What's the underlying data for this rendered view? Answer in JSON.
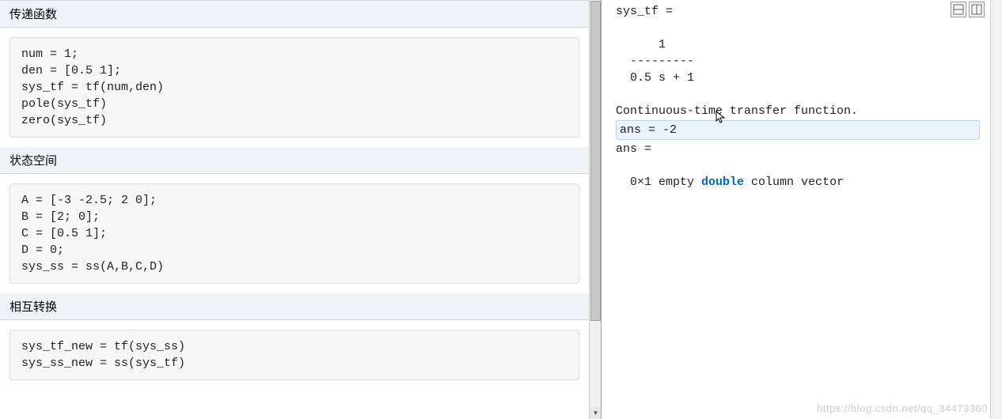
{
  "left": {
    "section1": {
      "title": "传递函数",
      "code": "num = 1;\nden = [0.5 1];\nsys_tf = tf(num,den)\npole(sys_tf)\nzero(sys_tf)"
    },
    "section2": {
      "title": "状态空间",
      "code": "A = [-3 -2.5; 2 0];\nB = [2; 0];\nC = [0.5 1];\nD = 0;\nsys_ss = ss(A,B,C,D)"
    },
    "section3": {
      "title": "相互转换",
      "code": "sys_tf_new = tf(sys_ss)\nsys_ss_new = ss(sys_tf)"
    }
  },
  "right": {
    "line1": "sys_tf =",
    "frac_num": "      1",
    "frac_div": "  ---------",
    "frac_den": "  0.5 s + 1",
    "line_desc": "Continuous-time transfer function.",
    "ans1": "ans = -2",
    "ans2": "ans =",
    "vec_prefix": "  0×1 empty ",
    "vec_kw": "double",
    "vec_suffix": " column vector"
  },
  "watermark": "https://blog.csdn.net/qq_34473360"
}
